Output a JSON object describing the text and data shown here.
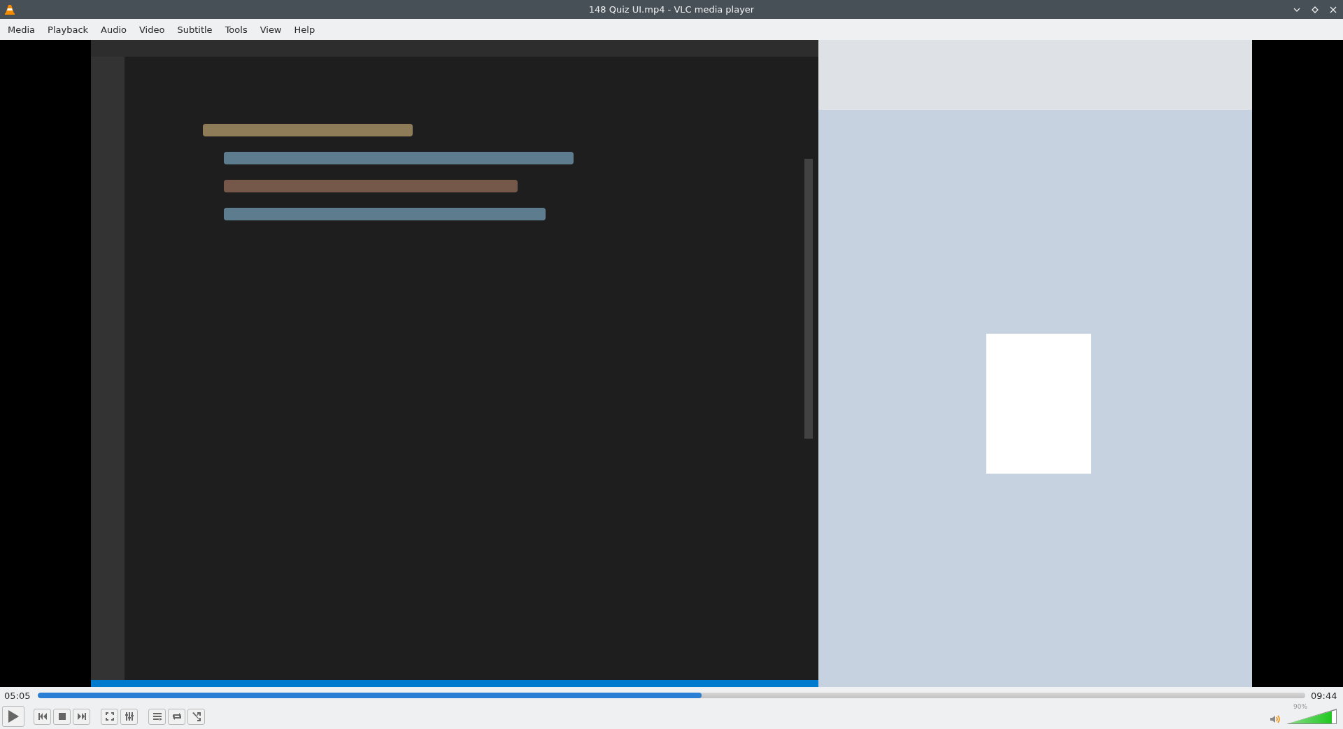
{
  "window": {
    "title": "148 Quiz UI.mp4 - VLC media player"
  },
  "menu": [
    "Media",
    "Playback",
    "Audio",
    "Video",
    "Subtitle",
    "Tools",
    "View",
    "Help"
  ],
  "seek": {
    "elapsed": "05:05",
    "total": "09:44",
    "level": 0.524
  },
  "volume": {
    "reading": "90%",
    "level": 0.9
  }
}
